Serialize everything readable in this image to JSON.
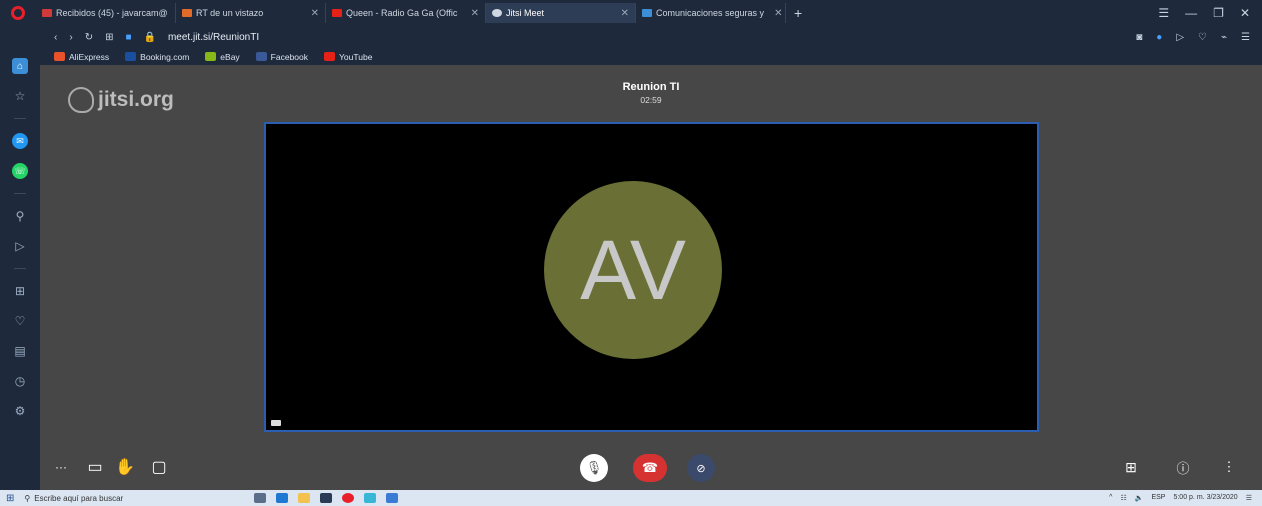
{
  "browser": {
    "tabs": [
      {
        "title": "Recibidos (45) - javarcam@",
        "color": "#d23a3a",
        "active": false
      },
      {
        "title": "RT de un vistazo",
        "color": "#e36b2a",
        "active": false
      },
      {
        "title": "Queen - Radio Ga Ga (Offic",
        "color": "#e62117",
        "active": false
      },
      {
        "title": "Jitsi Meet",
        "color": "#cfd6e2",
        "active": true
      },
      {
        "title": "Comunicaciones seguras y",
        "color": "#3c8ed6",
        "active": false
      }
    ],
    "new_tab": "+",
    "address": {
      "url": "meet.jit.si/ReunionTI"
    },
    "bookmarks": [
      {
        "label": "AliExpress",
        "color": "#e8532b"
      },
      {
        "label": "Booking.com",
        "color": "#1a4fa0"
      },
      {
        "label": "eBay",
        "color": "#86b817"
      },
      {
        "label": "Facebook",
        "color": "#3b5998"
      },
      {
        "label": "YouTube",
        "color": "#e62117"
      }
    ]
  },
  "meeting": {
    "logo": "jitsi.org",
    "title": "Reunion TI",
    "timer": "02:59",
    "avatar_initials": "AV"
  },
  "taskbar": {
    "search_placeholder": "Escribe aquí para buscar",
    "language": "ESP",
    "time": "5:00 p. m.",
    "date": "3/23/2020"
  }
}
